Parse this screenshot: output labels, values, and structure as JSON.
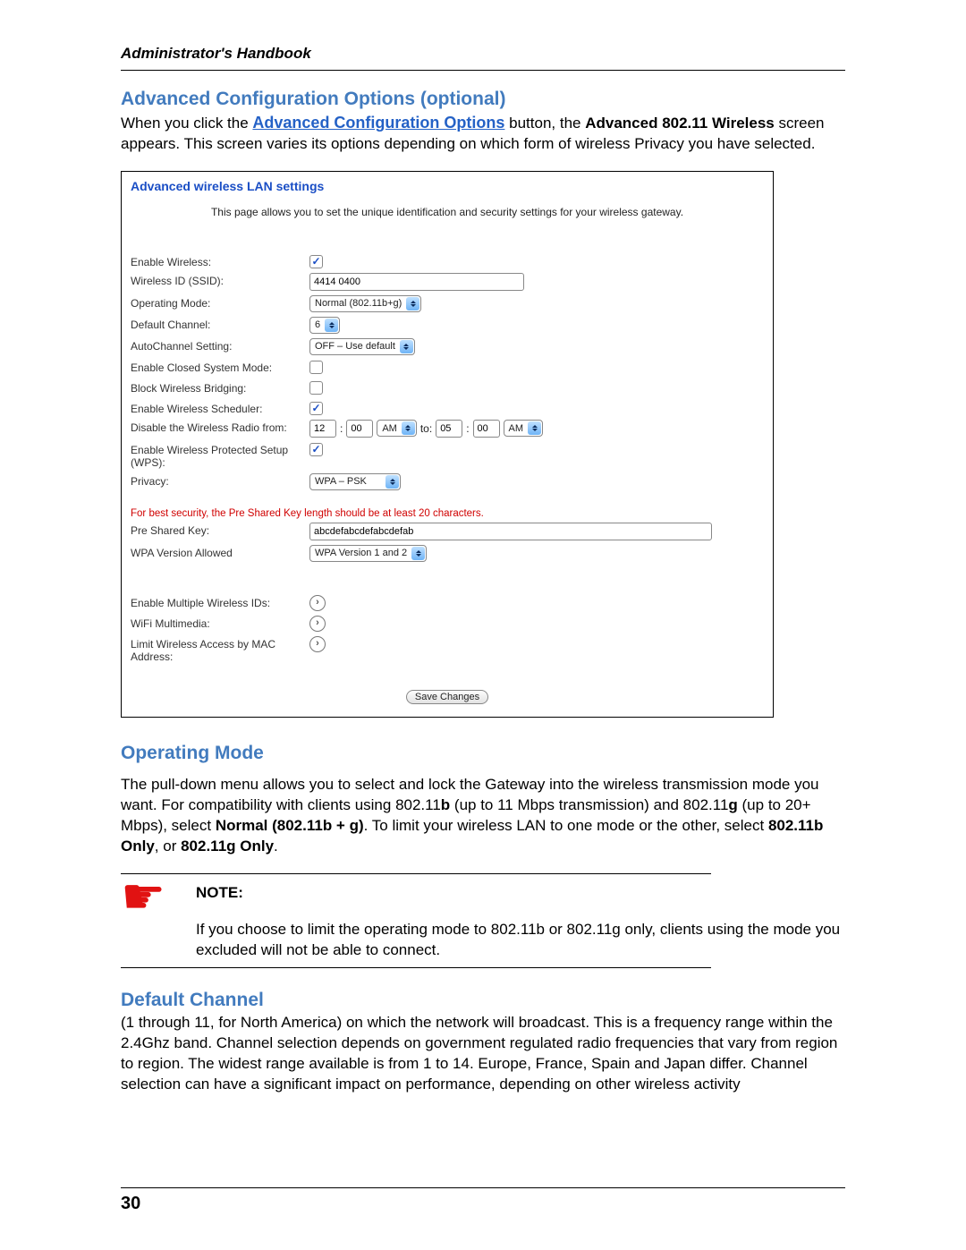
{
  "header": {
    "book_title": "Administrator's Handbook"
  },
  "advanced": {
    "heading": "Advanced Configuration Options (optional)",
    "p_before_link": "When you click the ",
    "link_text": "Advanced Configuration Options",
    "p_after_link_a": " button, the ",
    "bold_screen": "Advanced 802.11 Wireless",
    "p_after_link_b": " screen appears. This screen varies its options depending on which form of wireless Privacy you have selected."
  },
  "screenshot": {
    "title": "Advanced wireless LAN settings",
    "desc": "This page allows you to set the unique identification and security settings for your wireless gateway.",
    "labels": {
      "enable_wireless": "Enable Wireless:",
      "ssid": "Wireless ID (SSID):",
      "op_mode": "Operating Mode:",
      "def_channel": "Default Channel:",
      "autochannel": "AutoChannel Setting:",
      "closed_system": "Enable Closed System Mode:",
      "block_bridging": "Block Wireless Bridging:",
      "scheduler": "Enable Wireless Scheduler:",
      "disable_radio": "Disable the Wireless Radio from:",
      "wps": "Enable Wireless Protected Setup (WPS):",
      "privacy": "Privacy:",
      "psk": "Pre Shared Key:",
      "wpa_ver": "WPA Version Allowed",
      "multi_ids": "Enable Multiple Wireless IDs:",
      "wifi_mm": "WiFi Multimedia:",
      "mac_limit": "Limit Wireless Access by MAC Address:"
    },
    "values": {
      "ssid": "4414 0400",
      "op_mode": "Normal (802.11b+g)",
      "def_channel": "6",
      "autochannel": "OFF – Use default",
      "from_h": "12",
      "from_m": "00",
      "from_ampm": "AM",
      "to_word": "to:",
      "to_h": "05",
      "to_m": "00",
      "to_ampm": "AM",
      "privacy": "WPA – PSK",
      "psk": "abcdefabcdefabcdefab",
      "wpa_ver": "WPA Version 1 and 2"
    },
    "red_note": "For best security, the Pre Shared Key length should be at least 20 characters.",
    "save_btn": "Save Changes"
  },
  "operating_mode": {
    "heading": "Operating Mode",
    "p1a": "The pull-down menu allows you to select and lock the Gateway into the wireless transmission mode you want. For compatibility with clients using 802.11",
    "b1": "b",
    "p1b": " (up to 11 Mbps transmission) and 802.11",
    "b2": "g",
    "p1c": " (up to 20+ Mbps), select ",
    "b3": "Normal (802.11b + g)",
    "p1d": ". To limit your wireless LAN to one mode or the other, select ",
    "b4": "802.11b Only",
    "p1e": ", or ",
    "b5": "802.11g Only",
    "p1f": "."
  },
  "note": {
    "label": "NOTE:",
    "body": "If you choose to limit the operating mode to 802.11b or 802.11g only, clients using the mode you excluded will not be able to connect."
  },
  "default_channel": {
    "heading": "Default Channel",
    "p": "(1 through 11, for North America) on which the network will broadcast. This is a frequency range within the 2.4Ghz band. Channel selection depends on government regulated radio frequencies that vary from region to region. The widest range available is from 1 to 14. Europe, France, Spain and Japan differ. Channel selection can have a significant impact on performance, depending on other wireless activity"
  },
  "footer": {
    "page_number": "30"
  }
}
